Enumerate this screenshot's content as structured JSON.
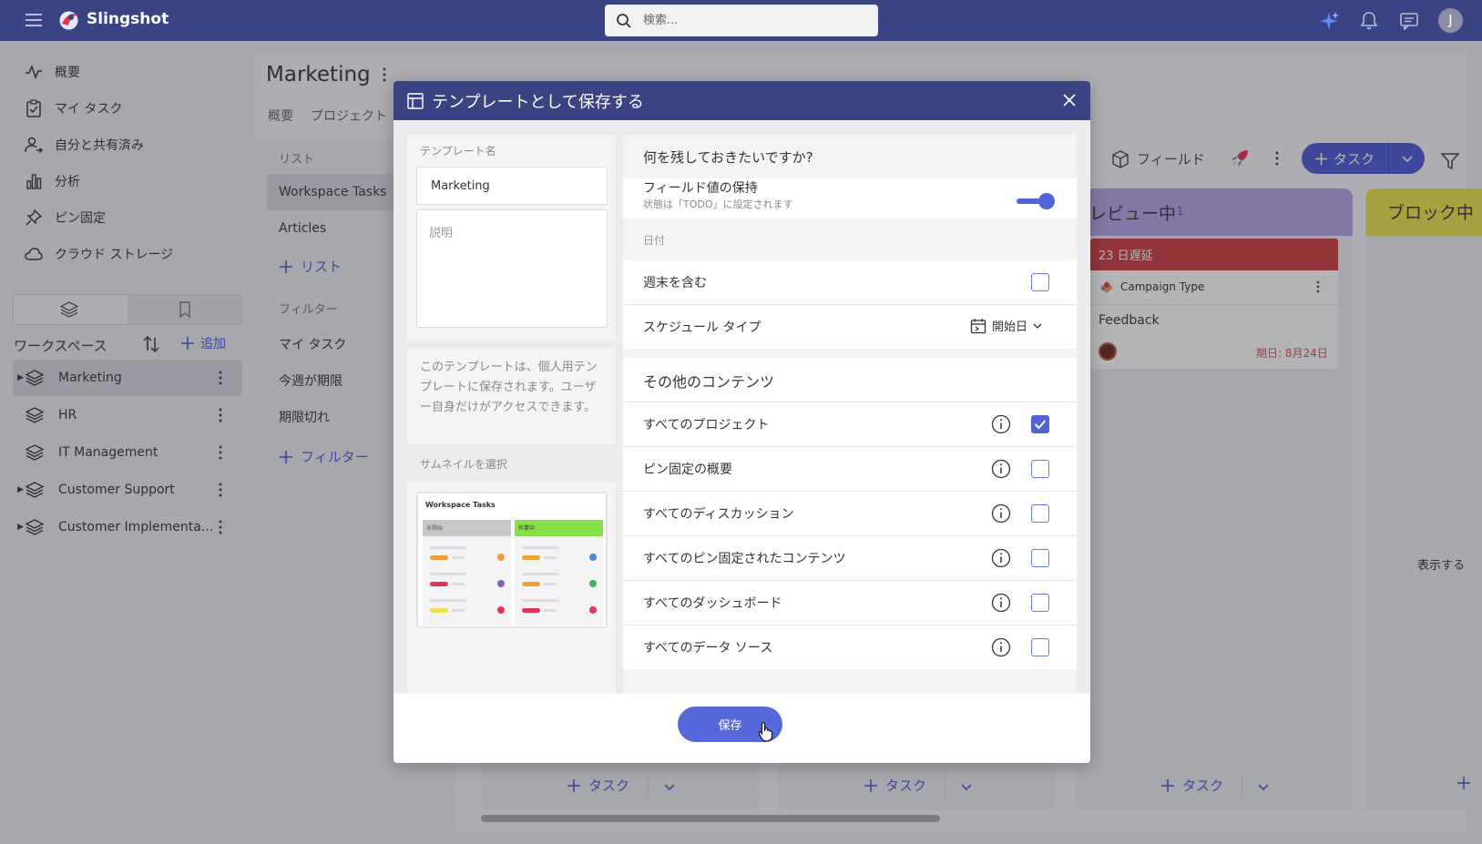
{
  "topbar": {
    "brand": "Slingshot",
    "search_placeholder": "検索...",
    "avatar_initial": "J",
    "icons": [
      "menu-icon",
      "sparkle-icon",
      "bell-icon",
      "chat-icon"
    ]
  },
  "nav": {
    "items": [
      {
        "label": "概要",
        "icon": "activity-icon"
      },
      {
        "label": "マイ タスク",
        "icon": "clipboard-icon"
      },
      {
        "label": "自分と共有済み",
        "icon": "user-share-icon"
      },
      {
        "label": "分析",
        "icon": "bar-chart-icon"
      },
      {
        "label": "ピン固定",
        "icon": "pin-icon"
      },
      {
        "label": "クラウド ストレージ",
        "icon": "cloud-icon"
      }
    ],
    "workspace_title": "ワークスペース",
    "add_label": "追加",
    "workspaces": [
      {
        "label": "Marketing",
        "selected": true,
        "expandable": true
      },
      {
        "label": "HR",
        "selected": false,
        "expandable": false
      },
      {
        "label": "IT Management",
        "selected": false,
        "expandable": false
      },
      {
        "label": "Customer Support",
        "selected": false,
        "expandable": true
      },
      {
        "label": "Customer Implementa...",
        "selected": false,
        "expandable": true
      }
    ]
  },
  "page": {
    "title": "Marketing",
    "tabs": [
      "概要",
      "プロジェクト"
    ]
  },
  "list_panel": {
    "list_label": "リスト",
    "lists": [
      "Workspace Tasks",
      "Articles"
    ],
    "add_list": "リスト",
    "filter_label": "フィルター",
    "filters": [
      "マイ タスク",
      "今週が期限",
      "期限切れ"
    ],
    "add_filter": "フィルター"
  },
  "board": {
    "fields_label": "フィールド",
    "task_button": "タスク",
    "columns": [
      {
        "title": "レビュー中",
        "count": "1",
        "color": "#b4a4e4"
      },
      {
        "title": "ブロック中",
        "color": "#ece34a"
      }
    ],
    "card": {
      "overdue": "23 日遅延",
      "type": "Campaign Type",
      "title": "Feedback",
      "due": "期日: 8月24日"
    },
    "empty_text": "表示する",
    "footer_add": "タスク"
  },
  "modal": {
    "title": "テンプレートとして保存する",
    "template_name_label": "テンプレート名",
    "template_name_value": "Marketing",
    "description_placeholder": "説明",
    "note": "このテンプレートは、個人用テンプレートに保存されます。ユーザー自身だけがアクセスできます。",
    "thumbnail_label": "サムネイルを選択",
    "thumbnail": {
      "title": "Workspace Tasks",
      "col1": "未開始",
      "col2": "作業中"
    },
    "question": "何を残しておきたいですか?",
    "keep_field_values": {
      "label": "フィールド値の保持",
      "sub": "状態は「TODO」に設定されます",
      "on": true
    },
    "date_section": "日付",
    "include_weekends": {
      "label": "週末を含む",
      "checked": false
    },
    "schedule_type": {
      "label": "スケジュール タイプ",
      "value": "開始日"
    },
    "other_section": "その他のコンテンツ",
    "other_items": [
      {
        "label": "すべてのプロジェクト",
        "checked": true
      },
      {
        "label": "ピン固定の概要",
        "checked": false
      },
      {
        "label": "すべてのディスカッション",
        "checked": false
      },
      {
        "label": "すべてのピン固定されたコンテンツ",
        "checked": false
      },
      {
        "label": "すべてのダッシュボード",
        "checked": false
      },
      {
        "label": "すべてのデータ ソース",
        "checked": false
      }
    ],
    "save_label": "保存"
  }
}
